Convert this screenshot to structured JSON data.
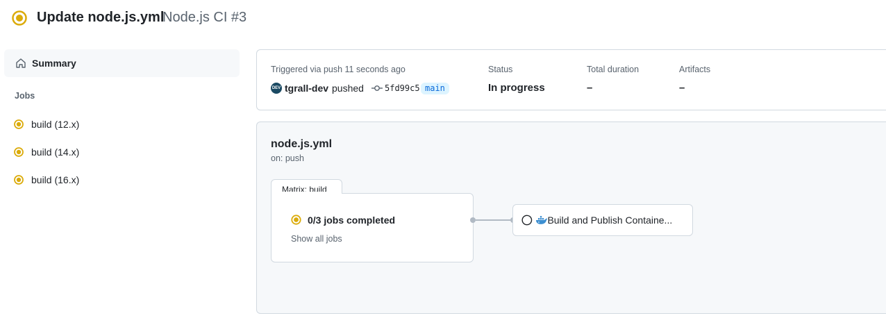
{
  "header": {
    "title": "Update node.js.yml",
    "subtitle": "Node.js CI #3",
    "status_icon": "in-progress-icon"
  },
  "sidebar": {
    "summary_label": "Summary",
    "jobs_heading": "Jobs",
    "jobs": [
      {
        "label": "build (12.x)",
        "status": "in-progress"
      },
      {
        "label": "build (14.x)",
        "status": "in-progress"
      },
      {
        "label": "build (16.x)",
        "status": "in-progress"
      }
    ]
  },
  "summary": {
    "trigger_text": "Triggered via push 11 seconds ago",
    "avatar_text": "DEV",
    "actor": "tgrall-dev",
    "action": "pushed",
    "commit_sha": "5fd99c5",
    "branch": "main",
    "status_label": "Status",
    "status_value": "In progress",
    "duration_label": "Total duration",
    "duration_value": "–",
    "artifacts_label": "Artifacts",
    "artifacts_value": "–"
  },
  "workflow": {
    "file": "node.js.yml",
    "trigger": "on: push",
    "matrix_tab": "Matrix: build",
    "matrix_progress": "0/3 jobs completed",
    "matrix_link": "Show all jobs",
    "next_job": "Build and Publish Containe...",
    "next_job_status": "queued"
  },
  "colors": {
    "in_progress": "#bf8700",
    "link": "#0969da",
    "muted": "#59636e",
    "border": "#d1d9e0"
  }
}
